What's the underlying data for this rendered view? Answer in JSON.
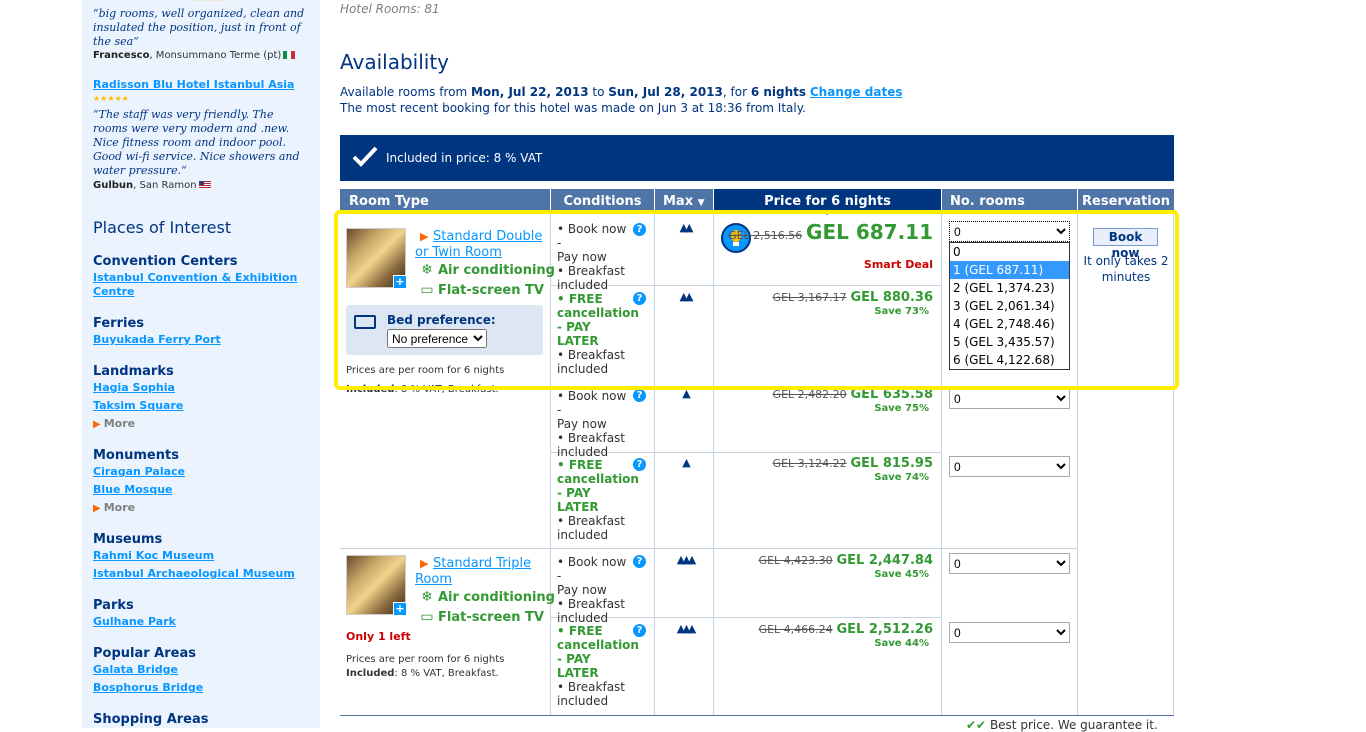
{
  "sidebar": {
    "review1": {
      "quote": "“big rooms, well organized, clean and insulated the position, just in front of the sea“",
      "author_name": "Francesco",
      "author_place": ", Monsummano Terme (pt)"
    },
    "review2": {
      "hotel_link": "Radisson Blu Hotel Istanbul Asia",
      "stars": "★★★★★",
      "quote": "“The staff was very friendly. The rooms were very modern and .new. Nice fitness room and indoor pool. Good wi-fi service. Nice showers and water pressure.“",
      "author_name": "Gulbun",
      "author_place": ", San Ramon"
    },
    "places_title": "Places of Interest",
    "categories": [
      {
        "title": "Convention Centers",
        "links": [
          "Istanbul Convention & Exhibition Centre"
        ]
      },
      {
        "title": "Ferries",
        "links": [
          "Buyukada Ferry Port"
        ]
      },
      {
        "title": "Landmarks",
        "links": [
          "Hagia Sophia",
          "Taksim Square"
        ],
        "more": "More"
      },
      {
        "title": "Monuments",
        "links": [
          "Ciragan Palace",
          "Blue Mosque"
        ],
        "more": "More"
      },
      {
        "title": "Museums",
        "links": [
          "Rahmi Koc Museum",
          "Istanbul Archaeological Museum"
        ]
      },
      {
        "title": "Parks",
        "links": [
          "Gulhane Park"
        ]
      },
      {
        "title": "Popular Areas",
        "links": [
          "Galata Bridge",
          "Bosphorus Bridge"
        ]
      },
      {
        "title": "Shopping Areas",
        "links": []
      }
    ]
  },
  "main": {
    "hotel_rooms": "Hotel Rooms: 81",
    "availability_title": "Availability",
    "avail_prefix": "Available rooms from ",
    "date_from": "Mon, Jul 22, 2013",
    "to_word": " to ",
    "date_to": "Sun, Jul 28, 2013",
    "for_word": ", for ",
    "nights": "6 nights",
    "change_dates": "Change dates",
    "recent_booking": "The most recent booking for this hotel was made on Jun 3 at 18:36 from Italy.",
    "vat_banner": "Included in price: 8 % VAT"
  },
  "table": {
    "headers": {
      "room_type": "Room Type",
      "conditions": "Conditions",
      "max": "Max",
      "price": "Price for 6 nights",
      "no_rooms": "No. rooms",
      "reservation": "Reservation"
    },
    "room1": {
      "name": "Standard Double or Twin Room",
      "facility_ac": "Air conditioning",
      "facility_tv": "Flat-screen TV",
      "bed_label": "Bed preference:",
      "bed_value": "No preference",
      "prices_note": "Prices are per room for 6 nights",
      "included_label": "Included",
      "included_text": ": 8 % VAT, Breakfast."
    },
    "room2": {
      "name": "Standard Triple Room",
      "facility_ac": "Air conditioning",
      "facility_tv": "Flat-screen TV",
      "only_left": "Only 1 left",
      "prices_note": "Prices are per room for 6 nights",
      "included_label": "Included",
      "included_text": ": 8 % VAT, Breakfast."
    },
    "cond_paynow": [
      "• Book now -",
      "Pay now",
      "• Breakfast",
      "included"
    ],
    "cond_free": [
      "• FREE",
      "cancellation",
      "- PAY",
      "LATER",
      "• Breakfast",
      "included"
    ],
    "rows": [
      {
        "old": "GEL 2,516.56",
        "new": "GEL 687.11",
        "tag": "Smart Deal",
        "rooms": "0",
        "max": "▲▲"
      },
      {
        "old": "GEL 3,167.17",
        "new": "GEL 880.36",
        "save": "Save 73%",
        "rooms": "0",
        "max": "▲▲"
      },
      {
        "old": "GEL 2,482.20",
        "new": "GEL 635.58",
        "save": "Save 75%",
        "rooms": "0",
        "max": "▲"
      },
      {
        "old": "GEL 3,124.22",
        "new": "GEL 815.95",
        "save": "Save 74%",
        "rooms": "0",
        "max": "▲"
      },
      {
        "old": "GEL 4,423.30",
        "new": "GEL 2,447.84",
        "save": "Save 45%",
        "rooms": "0",
        "max": "▲▲▲"
      },
      {
        "old": "GEL 4,466.24",
        "new": "GEL 2,512.26",
        "save": "Save 44%",
        "rooms": "0",
        "max": "▲▲▲"
      }
    ],
    "dropdown_options": [
      "0",
      "1 (GEL 687.11)",
      "2 (GEL 1,374.23)",
      "3 (GEL 2,061.34)",
      "4 (GEL 2,748.46)",
      "5 (GEL 3,435.57)",
      "6 (GEL 4,122.68)"
    ],
    "book_now": "Book now",
    "only_takes": "It only takes 2 minutes",
    "best_price": "Best price. We guarantee it."
  }
}
